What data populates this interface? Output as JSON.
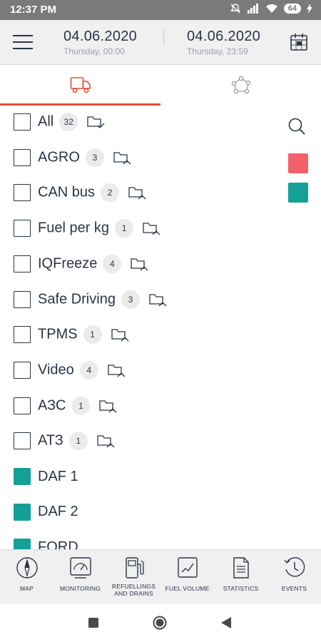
{
  "status_bar": {
    "time": "12:37 PM",
    "battery": "64"
  },
  "header": {
    "date_from": {
      "date": "04.06.2020",
      "sub": "Thursday, 00:00"
    },
    "date_to": {
      "date": "04.06.2020",
      "sub": "Thursday, 23:59"
    }
  },
  "tabs": [
    {
      "icon": "truck-icon",
      "active": true
    },
    {
      "icon": "geozone-icon",
      "active": false
    }
  ],
  "groups": [
    {
      "label": "All",
      "count": "32",
      "folder": "folder-check-icon"
    },
    {
      "label": "AGRO",
      "count": "3",
      "folder": "folder-edit-icon"
    },
    {
      "label": "CAN bus",
      "count": "2",
      "folder": "folder-edit-icon"
    },
    {
      "label": "Fuel per kg",
      "count": "1",
      "folder": "folder-edit-icon"
    },
    {
      "label": "IQFreeze",
      "count": "4",
      "folder": "folder-edit-icon"
    },
    {
      "label": "Safe Driving",
      "count": "3",
      "folder": "folder-edit-icon"
    },
    {
      "label": "TPMS",
      "count": "1",
      "folder": "folder-edit-icon"
    },
    {
      "label": "Video",
      "count": "4",
      "folder": "folder-edit-icon"
    },
    {
      "label": "АЗС",
      "count": "1",
      "folder": "folder-edit-icon"
    },
    {
      "label": "АТЗ",
      "count": "1",
      "folder": "folder-edit-icon"
    }
  ],
  "vehicles": [
    {
      "label": "DAF 1",
      "color": "#14a098"
    },
    {
      "label": "DAF 2",
      "color": "#14a098"
    },
    {
      "label": "FORD",
      "color": "#14a098"
    }
  ],
  "side_swatches": [
    "#f2616a",
    "#14a098"
  ],
  "colors": {
    "accent": "#e84b37",
    "teal": "#14a098",
    "red": "#f2616a"
  },
  "bottom_nav": [
    {
      "label": "MAP",
      "icon": "compass-icon"
    },
    {
      "label": "MONITORING",
      "icon": "monitoring-icon"
    },
    {
      "label": "REFUELLINGS AND DRAINS",
      "icon": "fuel-pump-icon"
    },
    {
      "label": "FUEL VOLUME",
      "icon": "fuel-chart-icon"
    },
    {
      "label": "STATISTICS",
      "icon": "document-icon"
    },
    {
      "label": "EVENTS",
      "icon": "events-clock-icon"
    }
  ]
}
